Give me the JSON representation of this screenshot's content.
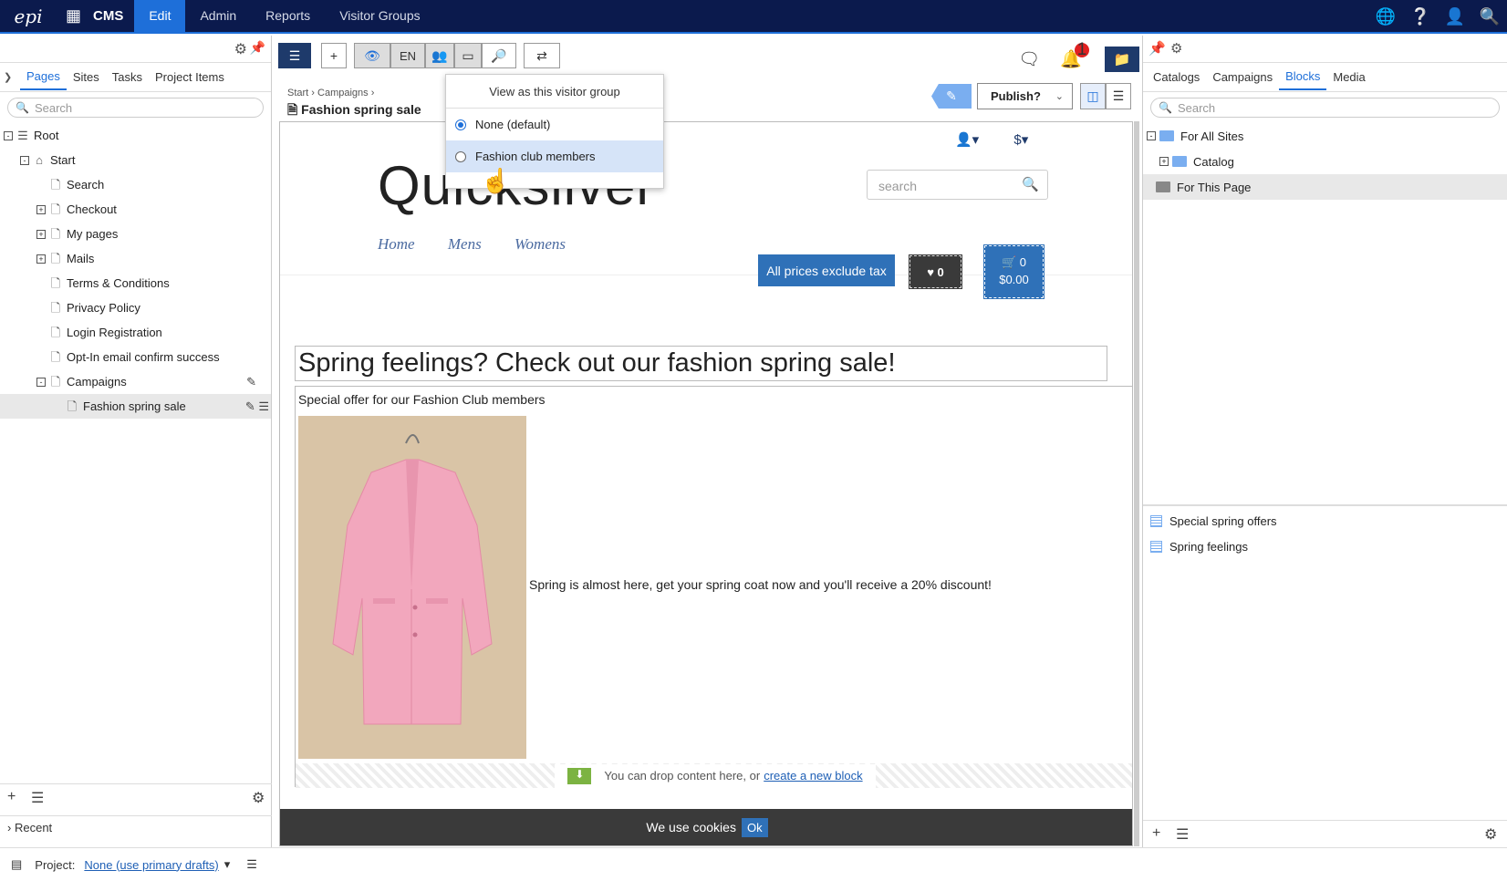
{
  "topnav": {
    "logo": "epi",
    "cms": "CMS",
    "items": [
      "Edit",
      "Admin",
      "Reports",
      "Visitor Groups"
    ],
    "active": "Edit"
  },
  "left": {
    "tabs": [
      "Pages",
      "Sites",
      "Tasks",
      "Project Items"
    ],
    "search_placeholder": "Search",
    "tree": [
      {
        "label": "Root",
        "level": 0,
        "exp": "-",
        "icon": "list-icon"
      },
      {
        "label": "Start",
        "level": 1,
        "exp": "-",
        "icon": "home-icon"
      },
      {
        "label": "Search",
        "level": 2,
        "exp": "",
        "icon": "page-icon"
      },
      {
        "label": "Checkout",
        "level": 2,
        "exp": "+",
        "icon": "page-icon"
      },
      {
        "label": "My pages",
        "level": 2,
        "exp": "+",
        "icon": "page-icon"
      },
      {
        "label": "Mails",
        "level": 2,
        "exp": "+",
        "icon": "page-icon"
      },
      {
        "label": "Terms & Conditions",
        "level": 2,
        "exp": "",
        "icon": "page-icon"
      },
      {
        "label": "Privacy Policy",
        "level": 2,
        "exp": "",
        "icon": "page-icon"
      },
      {
        "label": "Login Registration",
        "level": 2,
        "exp": "",
        "icon": "page-icon"
      },
      {
        "label": "Opt-In email confirm success",
        "level": 2,
        "exp": "",
        "icon": "page-icon"
      },
      {
        "label": "Campaigns",
        "level": 2,
        "exp": "-",
        "icon": "page-icon"
      },
      {
        "label": "Fashion spring sale",
        "level": 3,
        "exp": "",
        "icon": "page-icon",
        "selected": true
      }
    ],
    "recent": "Recent"
  },
  "center": {
    "lang": "EN",
    "breadcrumb": [
      "Start",
      "Campaigns"
    ],
    "title": "Fashion spring sale",
    "publish_label": "Publish?",
    "notification_count": "1",
    "dropdown": {
      "heading": "View as this visitor group",
      "options": [
        {
          "label": "None (default)",
          "checked": true
        },
        {
          "label": "Fashion club members",
          "checked": false
        }
      ]
    }
  },
  "preview": {
    "brand": "Quicksilver",
    "search_placeholder": "search",
    "nav": [
      "Home",
      "Mens",
      "Womens"
    ],
    "tax_label": "All prices exclude tax",
    "wishlist_count": "0",
    "cart_count": "0",
    "cart_total": "$0.00",
    "heading": "Spring feelings? Check out our fashion spring sale!",
    "subheading": "Special offer for our Fashion Club members",
    "body": "Spring is almost here, get your spring coat now and you'll receive a 20% discount!",
    "dropzone_text": "You can drop content here, or",
    "dropzone_link": "create a new block",
    "cookie_text": "We use cookies",
    "cookie_ok": "Ok"
  },
  "right": {
    "tabs": [
      "Catalogs",
      "Campaigns",
      "Blocks",
      "Media"
    ],
    "active_tab": "Blocks",
    "search_placeholder": "Search",
    "folders": [
      "For All Sites",
      "Catalog",
      "For This Page"
    ],
    "blocks": [
      "Special spring offers",
      "Spring feelings"
    ]
  },
  "footer": {
    "project_label": "Project:",
    "project_value": "None (use primary drafts)"
  },
  "colors": {
    "nav_bg": "#0b1a4d",
    "accent": "#1e6fd9",
    "tax_button": "#2f71b8"
  }
}
